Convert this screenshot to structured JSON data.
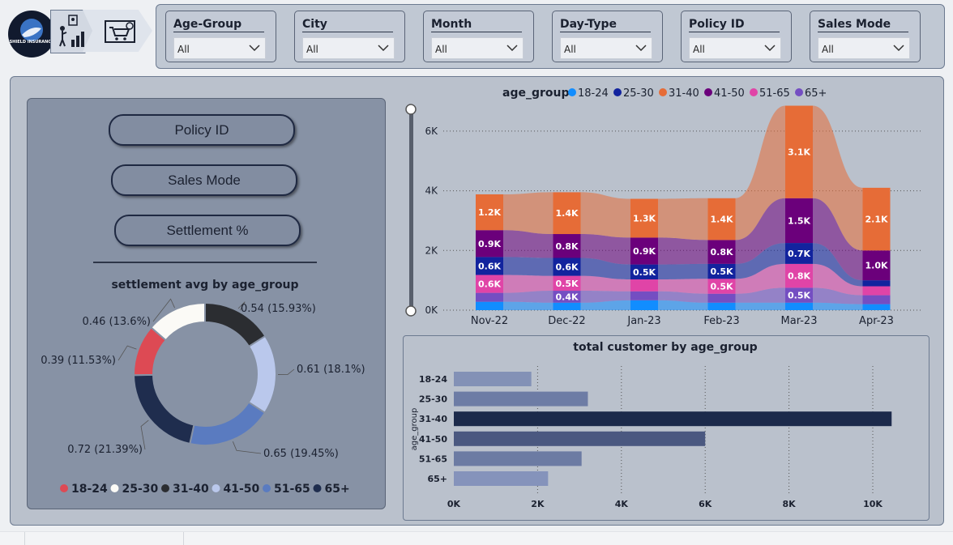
{
  "brand": {
    "logo_text": "SHIELD INSURANCE"
  },
  "slicers": [
    {
      "title": "Age-Group",
      "value": "All"
    },
    {
      "title": "City",
      "value": "All"
    },
    {
      "title": "Month",
      "value": "All"
    },
    {
      "title": "Day-Type",
      "value": "All"
    },
    {
      "title": "Policy ID",
      "value": "All"
    },
    {
      "title": "Sales Mode",
      "value": "All"
    }
  ],
  "nav_buttons": [
    "Policy ID",
    "Sales Mode",
    "Settlement %"
  ],
  "colors": {
    "navy": "#1f2942",
    "orange": "#e66c37",
    "purple": "#6b007b",
    "pink": "#e044a7",
    "darkblue": "#12239e",
    "lightblue": "#118dff",
    "lavender": "#744ec2"
  },
  "donut": {
    "title": "settlement avg by age_group",
    "slices": [
      {
        "label": "0.54 (15.93%)",
        "value": 0.54,
        "pct": 15.93,
        "group": "31-40",
        "color": "#2b2d31"
      },
      {
        "label": "0.61 (18.1%)",
        "value": 0.61,
        "pct": 18.1,
        "group": "41-50",
        "color": "#bac8ec"
      },
      {
        "label": "0.65 (19.45%)",
        "value": 0.65,
        "pct": 19.45,
        "group": "51-65",
        "color": "#5a7bc0"
      },
      {
        "label": "0.72 (21.39%)",
        "value": 0.72,
        "pct": 21.39,
        "group": "65+",
        "color": "#1f2d4e"
      },
      {
        "label": "0.39 (11.53%)",
        "value": 0.39,
        "pct": 11.53,
        "group": "18-24",
        "color": "#dd4a54"
      },
      {
        "label": "0.46 (13.6%)",
        "value": 0.46,
        "pct": 13.6,
        "group": "25-30",
        "color": "#fbfaf6"
      }
    ],
    "legend": [
      {
        "name": "18-24",
        "color": "#dd4a54"
      },
      {
        "name": "25-30",
        "color": "#fbfaf6"
      },
      {
        "name": "31-40",
        "color": "#2b2d31"
      },
      {
        "name": "41-50",
        "color": "#bac8ec"
      },
      {
        "name": "51-65",
        "color": "#5a7bc0"
      },
      {
        "name": "65+",
        "color": "#1f2d4e"
      }
    ]
  },
  "chart_data": [
    {
      "type": "area",
      "legend_title": "age_group",
      "legend": [
        {
          "name": "18-24",
          "color": "#118dff"
        },
        {
          "name": "25-30",
          "color": "#12239e"
        },
        {
          "name": "31-40",
          "color": "#e66c37"
        },
        {
          "name": "41-50",
          "color": "#6b007b"
        },
        {
          "name": "51-65",
          "color": "#e044a7"
        },
        {
          "name": "65+",
          "color": "#744ec2"
        }
      ],
      "categories": [
        "Nov-22",
        "Dec-22",
        "Jan-23",
        "Feb-23",
        "Mar-23",
        "Apr-23"
      ],
      "y_ticks": [
        "0K",
        "2K",
        "4K",
        "6K"
      ],
      "ylim": [
        0,
        7000
      ],
      "stack_order": [
        "18-24",
        "65+",
        "51-65",
        "25-30",
        "41-50",
        "31-40"
      ],
      "series": [
        {
          "name": "18-24",
          "values": [
            280,
            250,
            330,
            250,
            250,
            200
          ]
        },
        {
          "name": "25-30",
          "values": [
            600,
            600,
            500,
            500,
            700,
            200
          ]
        },
        {
          "name": "31-40",
          "values": [
            1200,
            1400,
            1300,
            1400,
            3100,
            2100
          ]
        },
        {
          "name": "41-50",
          "values": [
            900,
            800,
            900,
            800,
            1500,
            1000
          ]
        },
        {
          "name": "51-65",
          "values": [
            600,
            500,
            400,
            500,
            800,
            300
          ]
        },
        {
          "name": "65+",
          "values": [
            300,
            400,
            300,
            300,
            500,
            300
          ]
        }
      ],
      "data_labels": [
        {
          "cat": 0,
          "series": "31-40",
          "text": "1.2K"
        },
        {
          "cat": 0,
          "series": "41-50",
          "text": "0.9K"
        },
        {
          "cat": 0,
          "series": "25-30",
          "text": "0.6K"
        },
        {
          "cat": 0,
          "series": "51-65",
          "text": "0.6K"
        },
        {
          "cat": 1,
          "series": "31-40",
          "text": "1.4K"
        },
        {
          "cat": 1,
          "series": "41-50",
          "text": "0.8K"
        },
        {
          "cat": 1,
          "series": "25-30",
          "text": "0.6K"
        },
        {
          "cat": 1,
          "series": "51-65",
          "text": "0.5K"
        },
        {
          "cat": 1,
          "series": "65+",
          "text": "0.4K"
        },
        {
          "cat": 2,
          "series": "31-40",
          "text": "1.3K"
        },
        {
          "cat": 2,
          "series": "41-50",
          "text": "0.9K"
        },
        {
          "cat": 2,
          "series": "25-30",
          "text": "0.5K"
        },
        {
          "cat": 3,
          "series": "31-40",
          "text": "1.4K"
        },
        {
          "cat": 3,
          "series": "41-50",
          "text": "0.8K"
        },
        {
          "cat": 3,
          "series": "25-30",
          "text": "0.5K"
        },
        {
          "cat": 3,
          "series": "51-65",
          "text": "0.5K"
        },
        {
          "cat": 4,
          "series": "31-40",
          "text": "3.1K"
        },
        {
          "cat": 4,
          "series": "41-50",
          "text": "1.5K"
        },
        {
          "cat": 4,
          "series": "51-65",
          "text": "0.8K"
        },
        {
          "cat": 4,
          "series": "25-30",
          "text": "0.7K"
        },
        {
          "cat": 4,
          "series": "65+",
          "text": "0.5K"
        },
        {
          "cat": 5,
          "series": "31-40",
          "text": "2.1K"
        },
        {
          "cat": 5,
          "series": "41-50",
          "text": "1.0K"
        }
      ]
    },
    {
      "type": "bar",
      "orientation": "horizontal",
      "title": "total customer by age_group",
      "ylabel": "age_group",
      "categories": [
        "18-24",
        "25-30",
        "31-40",
        "41-50",
        "51-65",
        "65+"
      ],
      "values": [
        1850,
        3200,
        10450,
        6000,
        3050,
        2250
      ],
      "colors": [
        "#8391b6",
        "#6d7ca5",
        "#1c2a4b",
        "#4a5880",
        "#6c7ba3",
        "#8593bb"
      ],
      "x_ticks": [
        "0K",
        "2K",
        "4K",
        "6K",
        "8K",
        "10K"
      ],
      "xlim": [
        0,
        10000
      ]
    }
  ]
}
